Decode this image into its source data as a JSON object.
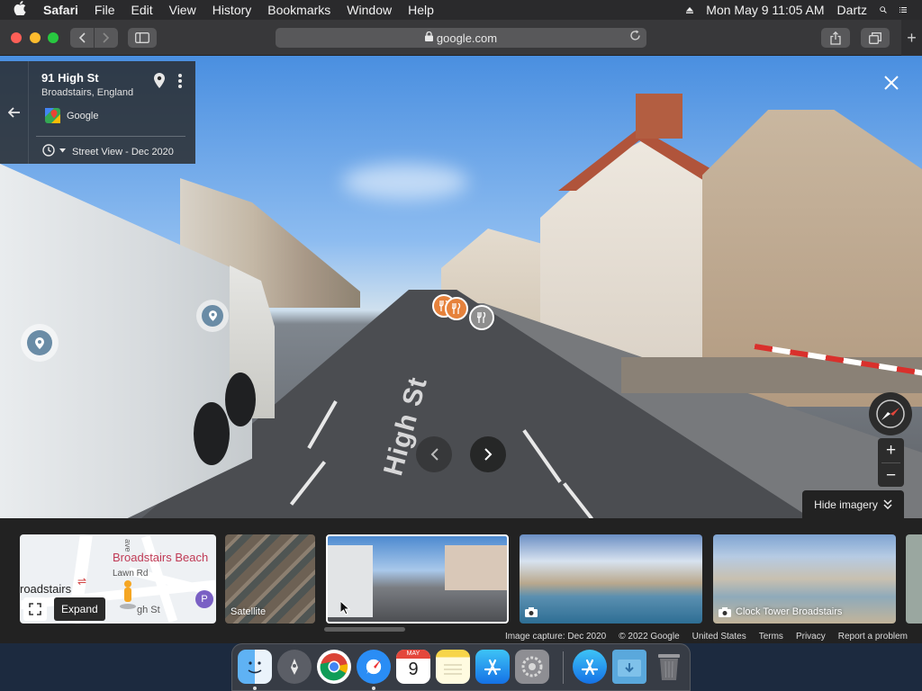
{
  "menubar": {
    "app": "Safari",
    "items": [
      "File",
      "Edit",
      "View",
      "History",
      "Bookmarks",
      "Window",
      "Help"
    ],
    "datetime": "Mon May 9  11:05 AM",
    "user": "Dartz"
  },
  "toolbar": {
    "url": "google.com"
  },
  "info_card": {
    "title": "91 High St",
    "subtitle": "Broadstairs, England",
    "source": "Google",
    "history_label": "Street View - Dec 2020"
  },
  "scene": {
    "road_text": "High St"
  },
  "controls": {
    "zoom_in": "+",
    "zoom_out": "−",
    "hide_imagery": "Hide imagery"
  },
  "thumbnails": {
    "map": {
      "place": "Broadstairs Beach",
      "town": "roadstairs",
      "street1": "Lawn Rd",
      "street2": "gh St",
      "street3": "ave",
      "parking": "P",
      "expand_tooltip": "Expand"
    },
    "satellite": "Satellite",
    "clock_tower": "Clock Tower Broadstairs"
  },
  "footer": {
    "capture": "Image capture: Dec 2020",
    "copyright": "© 2022 Google",
    "country": "United States",
    "terms": "Terms",
    "privacy": "Privacy",
    "report": "Report a problem"
  },
  "dock": {
    "calendar_month": "MAY",
    "calendar_day": "9"
  },
  "colors": {
    "menubar_bg": "#2a2a2c",
    "toolbar_bg": "#38383a",
    "strip_bg": "#222222",
    "beach_label": "#c03a55",
    "traffic_red": "#fe5f57",
    "traffic_yellow": "#febc2e",
    "traffic_green": "#28c840"
  }
}
